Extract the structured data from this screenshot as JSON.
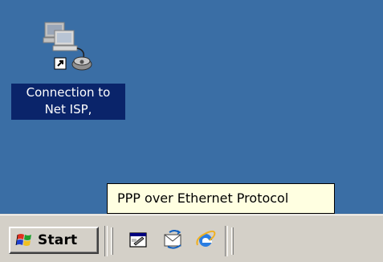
{
  "desktop": {
    "background": "#3a6ea5",
    "icon": {
      "name": "connection-icon",
      "label_line1": "Connection to",
      "label_line2": "Net ISP,"
    }
  },
  "tooltip": {
    "text": "PPP over Ethernet Protocol",
    "background": "#ffffe1"
  },
  "taskbar": {
    "start_label": "Start",
    "quick_launch": [
      {
        "icon": "show-desktop-icon"
      },
      {
        "icon": "outlook-express-icon"
      },
      {
        "icon": "internet-explorer-icon"
      }
    ]
  }
}
